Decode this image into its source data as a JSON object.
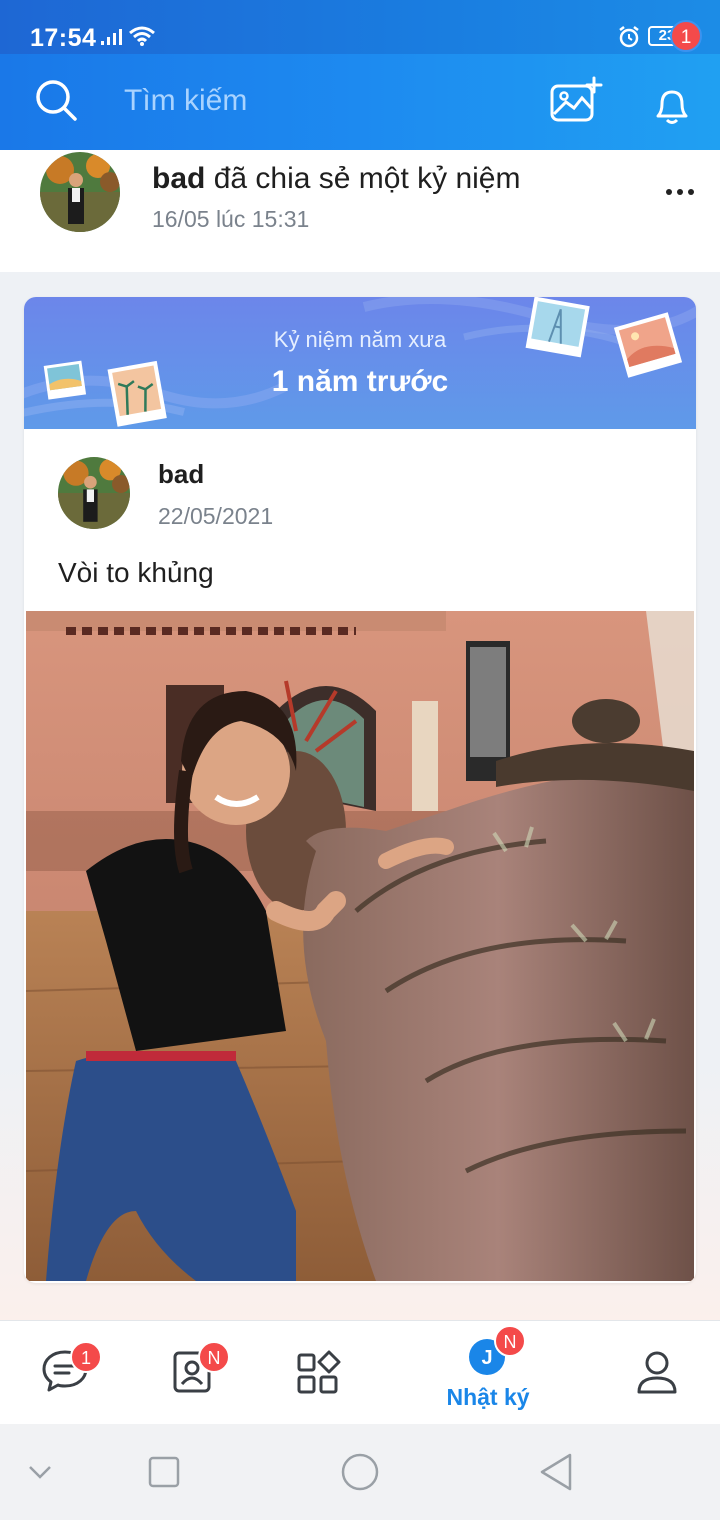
{
  "status_bar": {
    "time": "17:54",
    "battery": "23"
  },
  "header": {
    "search_placeholder": "Tìm kiếm",
    "notification_count": "1"
  },
  "share": {
    "user": "bad",
    "action": "đã chia sẻ một kỷ niệm",
    "time": "16/05 lúc 15:31"
  },
  "memory": {
    "label": "Kỷ niệm năm xưa",
    "years_ago": "1 năm trước"
  },
  "post": {
    "author": "bad",
    "date": "22/05/2021",
    "text": "Vòi to khủng"
  },
  "bottom_nav": {
    "messages_badge": "1",
    "contacts_badge": "N",
    "timeline_badge": "N",
    "timeline_label": "Nhật ký",
    "timeline_avatar_letter": "J"
  },
  "colors": {
    "brand": "#1a86e8",
    "badge": "#f44a4a"
  }
}
